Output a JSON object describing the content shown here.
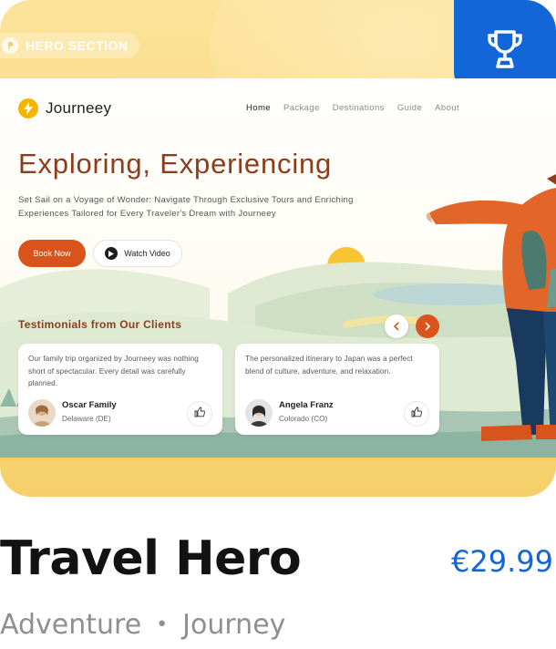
{
  "badge": {
    "label": "HERO SECTION",
    "icon": "p-logo-icon"
  },
  "award_icon": "trophy-icon",
  "preview": {
    "brand": "Journeey",
    "nav": [
      "Home",
      "Package",
      "Destinations",
      "Guide",
      "About"
    ],
    "active_nav": "Home",
    "headline": "Exploring, Experiencing",
    "subtitle": "Set Sail on a Voyage of Wonder: Navigate Through Exclusive Tours and Enriching Experiences Tailored for Every Traveler's Dream with Journeey",
    "primary_cta": "Book Now",
    "secondary_cta": "Watch Video",
    "testimonials_title": "Testimonials from Our Clients",
    "testimonials": [
      {
        "quote": "Our family trip organized by Journeey was nothing short of spectacular. Every detail was carefully planned.",
        "name": "Oscar Family",
        "location": "Delaware (DE)"
      },
      {
        "quote": "The personalized itinerary to Japan was a perfect blend of culture, adventure, and relaxation.",
        "name": "Angela Franz",
        "location": "Colorado (CO)"
      }
    ]
  },
  "product": {
    "title": "Travel Hero",
    "price": "€29.99",
    "tags": [
      "Adventure",
      "Journey"
    ],
    "separator": "•"
  },
  "colors": {
    "accent_blue": "#1266d8",
    "brand_orange": "#d9541c",
    "headline_brown": "#8c3d1c",
    "card_yellow": "#fbd878"
  }
}
